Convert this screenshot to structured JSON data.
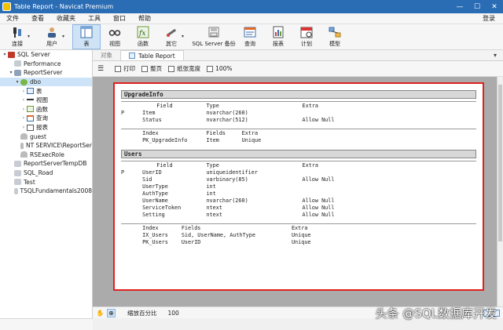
{
  "window": {
    "title": "Table Report - Navicat Premium",
    "buttons": [
      "—",
      "☐",
      "✕"
    ]
  },
  "menu": {
    "items": [
      "文件",
      "查看",
      "收藏夹",
      "工具",
      "窗口",
      "帮助"
    ],
    "login": "登录"
  },
  "toolbar": {
    "buttons": [
      {
        "label": "连接",
        "icon": "plug-icon"
      },
      {
        "label": "用户",
        "icon": "user-icon"
      },
      {
        "label": "表",
        "icon": "table-icon"
      },
      {
        "label": "视图",
        "icon": "glasses-icon"
      },
      {
        "label": "函数",
        "icon": "function-icon"
      },
      {
        "label": "其它",
        "icon": "tools-icon"
      },
      {
        "label": "SQL Server 备份",
        "icon": "backup-icon"
      },
      {
        "label": "查询",
        "icon": "query-icon"
      },
      {
        "label": "报表",
        "icon": "report-icon"
      },
      {
        "label": "计划",
        "icon": "calendar-icon"
      },
      {
        "label": "模型",
        "icon": "model-icon"
      }
    ]
  },
  "nav": {
    "items": [
      {
        "label": "SQL Server",
        "level": 0,
        "toggle": "v"
      },
      {
        "label": "Performance",
        "level": 1,
        "toggle": ""
      },
      {
        "label": "ReportServer",
        "level": 1,
        "toggle": "v"
      },
      {
        "label": "dbo",
        "level": 2,
        "toggle": "v"
      },
      {
        "label": "表",
        "level": 3,
        "toggle": ">"
      },
      {
        "label": "视图",
        "level": 3,
        "toggle": ">"
      },
      {
        "label": "函数",
        "level": 3,
        "toggle": ">"
      },
      {
        "label": "查询",
        "level": 3,
        "toggle": ">"
      },
      {
        "label": "报表",
        "level": 3,
        "toggle": ">"
      },
      {
        "label": "guest",
        "level": 2,
        "toggle": ""
      },
      {
        "label": "NT SERVICE\\ReportSer",
        "level": 2,
        "toggle": ""
      },
      {
        "label": "RSExecRole",
        "level": 2,
        "toggle": ""
      },
      {
        "label": "ReportServerTempDB",
        "level": 1,
        "toggle": ""
      },
      {
        "label": "SQL_Road",
        "level": 1,
        "toggle": ""
      },
      {
        "label": "Test",
        "level": 1,
        "toggle": ""
      },
      {
        "label": "TSQLFundamentals2008",
        "level": 1,
        "toggle": ""
      }
    ],
    "selected_index": 3
  },
  "tabs": {
    "objects_tab": "对象",
    "active_tab": "Table Report",
    "more": "▾"
  },
  "report_toolbar": {
    "menu": "☰",
    "print": "打印",
    "whole_page": "整页",
    "page_width": "纸张宽度",
    "zoom_100": "100%"
  },
  "report": {
    "sections": [
      {
        "name": "UpgradeInfo",
        "field_headers": [
          "Field",
          "Type",
          "Extra"
        ],
        "fields": [
          {
            "key": "P",
            "field": "Item",
            "type": "nvarchar(260)",
            "extra": ""
          },
          {
            "key": "",
            "field": "Status",
            "type": "nvarchar(512)",
            "extra": "Allow Null"
          }
        ],
        "index_headers": [
          "Index",
          "Fields",
          "Extra"
        ],
        "indexes": [
          {
            "index": "PK_UpgradeInfo",
            "fields": "Item",
            "extra": "Unique"
          }
        ]
      },
      {
        "name": "Users",
        "field_headers": [
          "Field",
          "Type",
          "Extra"
        ],
        "fields": [
          {
            "key": "P",
            "field": "UserID",
            "type": "uniqueidentifier",
            "extra": ""
          },
          {
            "key": "",
            "field": "Sid",
            "type": "varbinary(85)",
            "extra": "Allow Null"
          },
          {
            "key": "",
            "field": "UserType",
            "type": "int",
            "extra": ""
          },
          {
            "key": "",
            "field": "AuthType",
            "type": "int",
            "extra": ""
          },
          {
            "key": "",
            "field": "UserName",
            "type": "nvarchar(260)",
            "extra": "Allow Null"
          },
          {
            "key": "",
            "field": "ServiceToken",
            "type": "ntext",
            "extra": "Allow Null"
          },
          {
            "key": "",
            "field": "Setting",
            "type": "ntext",
            "extra": "Allow Null"
          }
        ],
        "index_headers": [
          "Index",
          "Fields",
          "Extra"
        ],
        "indexes": [
          {
            "index": "IX_Users",
            "fields": "Sid, UserName, AuthType",
            "extra": "Unique"
          },
          {
            "index": "PK_Users",
            "fields": "UserID",
            "extra": "Unique"
          }
        ]
      }
    ]
  },
  "status": {
    "zoom_label": "缩放百分比",
    "zoom_value": "100"
  },
  "watermark": "头条 @SQL数据库开发"
}
